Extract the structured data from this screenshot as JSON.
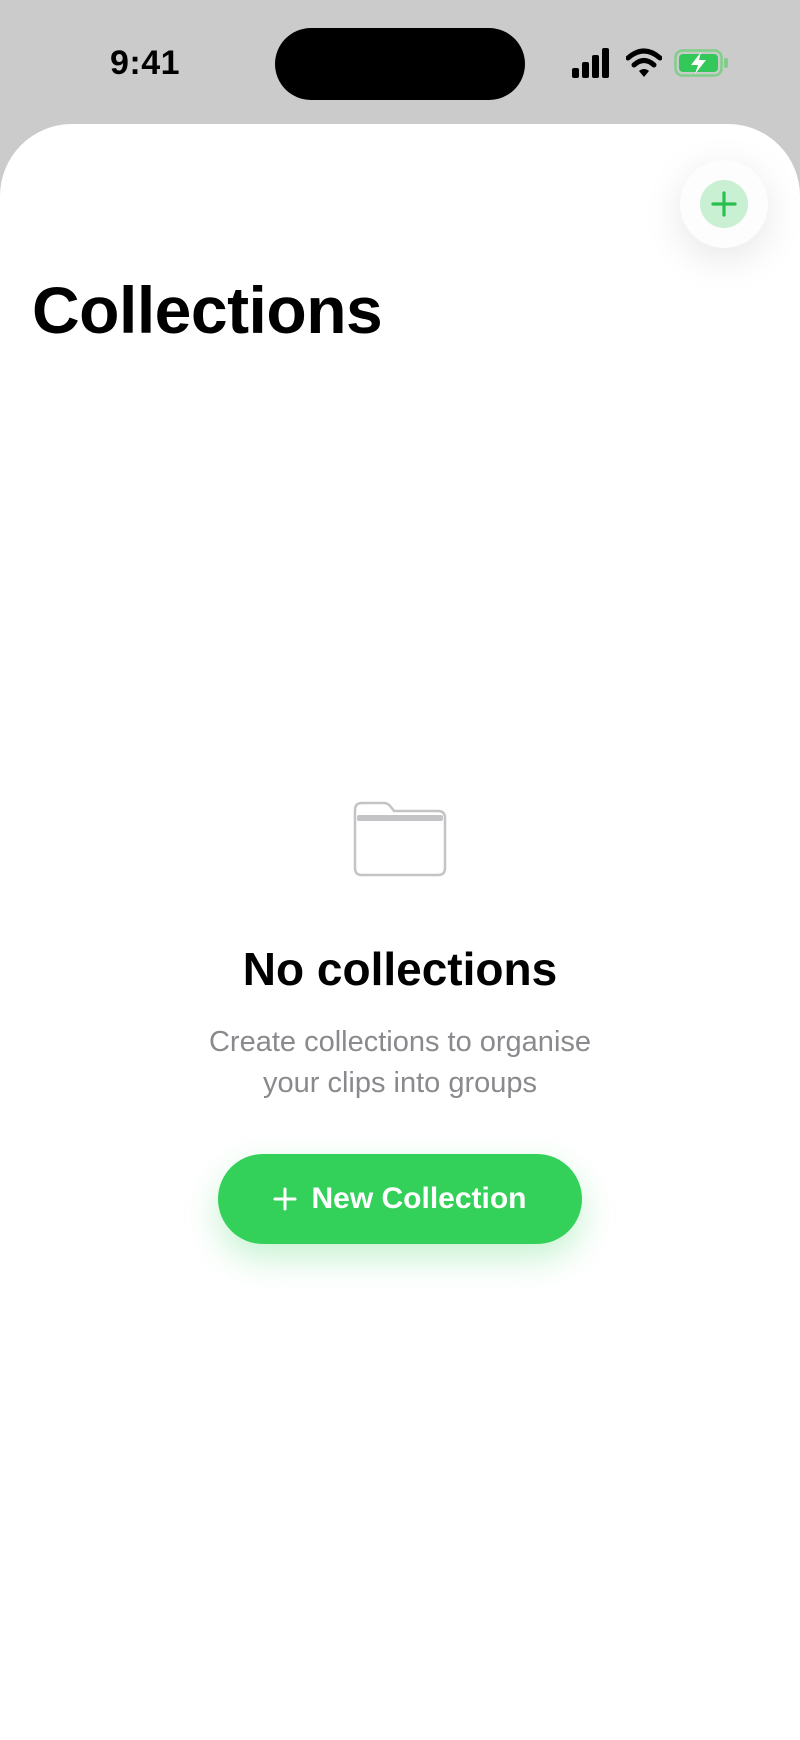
{
  "status_bar": {
    "time": "9:41",
    "icons": [
      "cellular-signal-icon",
      "wifi-icon",
      "battery-charging-icon"
    ]
  },
  "header": {
    "add_button_icon": "plus-icon",
    "title": "Collections"
  },
  "empty_state": {
    "icon": "folder-icon",
    "title": "No collections",
    "description": "Create collections to organise your clips into groups",
    "button_label": "New Collection",
    "button_icon": "plus-icon"
  },
  "colors": {
    "accent": "#34d15a",
    "accent_light": "#c9f0d2",
    "secondary_text": "#8a8a8e",
    "background": "#ffffff",
    "status_background": "#cbcbcb"
  }
}
